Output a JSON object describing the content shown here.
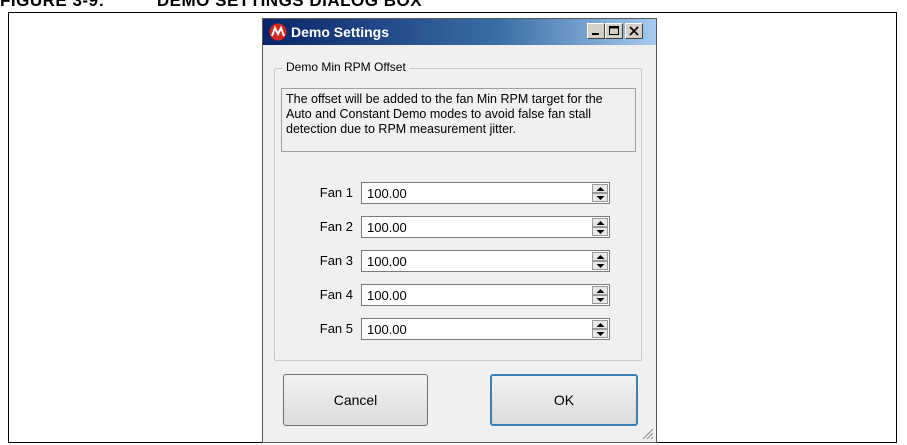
{
  "caption": "FIGURE 3-9:          DEMO SETTINGS DIALOG BOX",
  "window": {
    "title": "Demo Settings",
    "minimize_label": "minimize",
    "maximize_label": "maximize",
    "close_label": "close"
  },
  "group": {
    "label": "Demo Min RPM Offset",
    "description": "The offset will be added to the fan Min RPM target for the Auto and Constant Demo modes to avoid false fan stall detection due to RPM measurement jitter."
  },
  "fans": [
    {
      "label": "Fan 1",
      "value": "100.00"
    },
    {
      "label": "Fan 2",
      "value": "100.00"
    },
    {
      "label": "Fan 3",
      "value": "100.00"
    },
    {
      "label": "Fan 4",
      "value": "100.00"
    },
    {
      "label": "Fan 5",
      "value": "100.00"
    }
  ],
  "buttons": {
    "cancel": "Cancel",
    "ok": "OK"
  },
  "colors": {
    "titlebar_start": "#0a246a",
    "titlebar_end": "#a6caf0",
    "app_icon": "#d7261e"
  },
  "icons": [
    "microchip-logo-icon",
    "minimize-icon",
    "maximize-icon",
    "close-icon",
    "spin-up-icon",
    "spin-down-icon",
    "resize-grip-icon"
  ]
}
